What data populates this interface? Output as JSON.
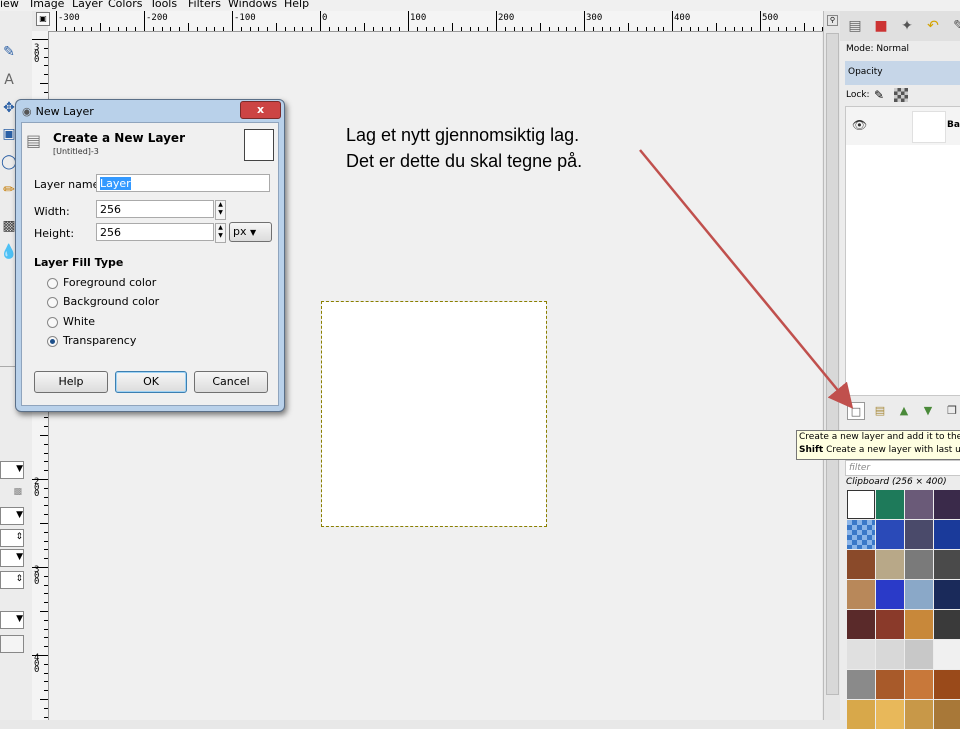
{
  "menubar": {
    "items": [
      "iew",
      "Image",
      "Layer",
      "Colors",
      "Tools",
      "Filters",
      "Windows",
      "Help"
    ]
  },
  "ruler": {
    "h_labels": [
      "-300",
      "-200",
      "-100",
      "0",
      "100",
      "200",
      "300",
      "400",
      "500"
    ],
    "v_labels": [
      "300",
      "200",
      "300",
      "400"
    ]
  },
  "dock": {
    "mode_label": "Mode: Normal",
    "opacity_label": "Opacity",
    "lock_label": "Lock:",
    "layer_name": "Bac",
    "tooltip_line1": "Create a new layer and add it to the",
    "tooltip_line2_key": "Shift",
    "tooltip_line2_text": "Create a new layer with last u",
    "filter_placeholder": "filter",
    "clipboard_label": "Clipboard (256 × 400)"
  },
  "dialog": {
    "title": "New Layer",
    "close": "x",
    "heading": "Create a New Layer",
    "subheading": "[Untitled]-3",
    "layer_name_label": "Layer name:",
    "layer_name_value": "Layer",
    "width_label": "Width:",
    "width_value": "256",
    "height_label": "Height:",
    "height_value": "256",
    "unit": "px",
    "fill_type_heading": "Layer Fill Type",
    "fill_options": [
      "Foreground color",
      "Background color",
      "White",
      "Transparency"
    ],
    "selected_fill": "Transparency",
    "help_button": "Help",
    "ok_button": "OK",
    "cancel_button": "Cancel"
  },
  "annotation": {
    "line1": "Lag et nytt gjennomsiktig lag.",
    "line2": "Det er dette du skal tegne på."
  },
  "colors": {
    "arrow": "#c0504d",
    "selection_outline": "#8a7f00",
    "dialog_frame": "#b9d1ea"
  }
}
